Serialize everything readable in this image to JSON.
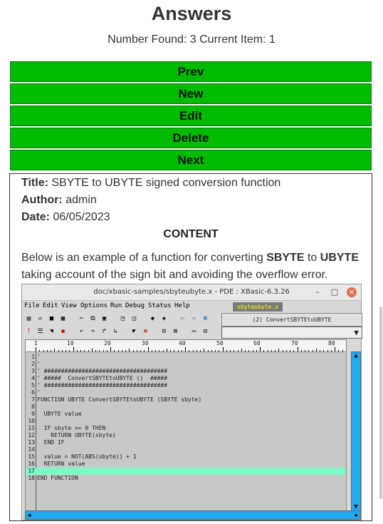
{
  "header": {
    "title": "Answers",
    "status": "Number Found: 3 Current Item: 1"
  },
  "buttons": {
    "prev": "Prev",
    "new": "New",
    "edit": "Edit",
    "delete": "Delete",
    "next": "Next"
  },
  "record": {
    "title_label": "Title:",
    "title_value": "SBYTE to UBYTE signed conversion function",
    "author_label": "Author:",
    "author_value": "admin",
    "date_label": "Date:",
    "date_value": "06/05/2023",
    "content_heading": "CONTENT",
    "para_1": "Below is an example of a function for converting ",
    "para_b1": "SBYTE",
    "para_2": " to ",
    "para_b2": "UBYTE",
    "para_3": " taking account of the sign bit and avoiding the overflow error."
  },
  "pde": {
    "window_title": "doc/xbasic-samples/sbyteubyte.x - PDE : XBasic-6.3.26",
    "minimize": "–",
    "maximize": "□",
    "close": "×",
    "menus": [
      "File",
      "Edit",
      "View",
      "Options",
      "Run",
      "Debug",
      "Status",
      "Help"
    ],
    "file_tag": "sbyteubyte.x",
    "proc_box": "(2) ConvertSBYTEtoUBYTE",
    "combo_arrow": "▼",
    "ruler_marks": [
      "1",
      "10",
      "20",
      "30",
      "40",
      "50",
      "60",
      "70",
      "80"
    ],
    "line_numbers": [
      "1",
      "2",
      "3",
      "4",
      "5",
      "6",
      "7",
      "8",
      "9",
      "10",
      "11",
      "12",
      "13",
      "14",
      "15",
      "16",
      "17",
      "18"
    ],
    "code_lines": [
      "'",
      "'",
      "' ####################################",
      "' #####  ConvertSBYTEtoUBYTE ()  #####",
      "' ####################################",
      "'",
      "FUNCTION UBYTE ConvertSBYTEtoUBYTE (SBYTE sbyte)",
      "",
      "  UBYTE value",
      "",
      "  IF sbyte >= 0 THEN",
      "    RETURN UBYTE(sbyte)",
      "  END IF",
      "",
      "  value = NOT(ABS(sbyte)) + 1",
      "  RETURN value",
      "",
      "END FUNCTION"
    ],
    "highlighted_line": 17,
    "scroll_up": "▲",
    "scroll_down": "▼",
    "scroll_left": "◀",
    "scroll_right": "▶"
  }
}
